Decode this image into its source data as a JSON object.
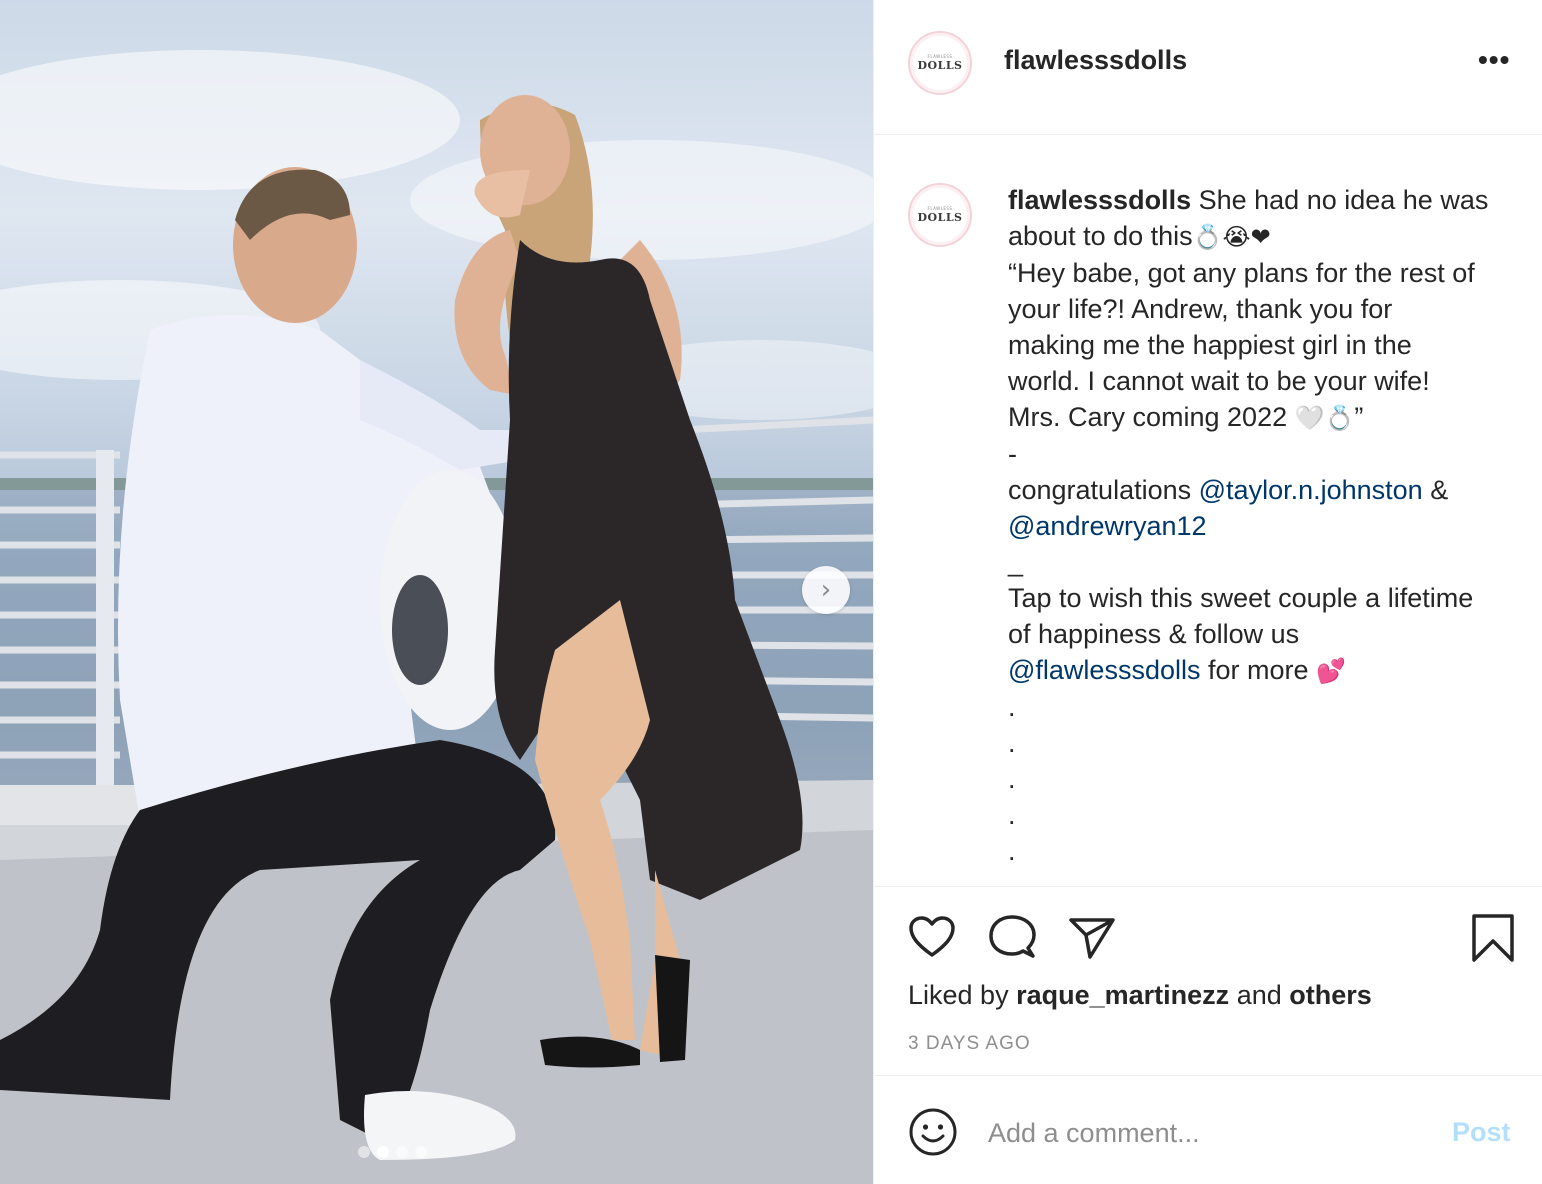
{
  "post": {
    "username": "flawlesssdolls",
    "avatar": {
      "top_text": "FLAWLESS",
      "main_text": "DOLLS"
    },
    "more_label": "•••",
    "next_arrow": "›",
    "carousel": {
      "slide_count": 4,
      "active_index": 1
    }
  },
  "caption": {
    "username": "flawlesssdolls",
    "line1": "She had no idea he was",
    "line2": "about to do this",
    "line2_emoji": "💍😭❤",
    "line3": "“Hey babe, got any plans for the rest of",
    "line4": "your life?! Andrew, thank you for",
    "line5": "making me the happiest girl in the",
    "line6": "world. I cannot wait to be your wife!",
    "line7": "Mrs. Cary coming 2022",
    "line7_emoji": "🤍💍",
    "line7_end": "”",
    "line8": "-",
    "line9_prefix": "congratulations",
    "mention1": "@taylor.n.johnston",
    "line9_suffix": "&",
    "mention2": "@andrewryan12",
    "line11": "_",
    "line12": "Tap to wish this sweet couple a lifetime",
    "line13": "of happiness & follow us",
    "mention3": "@flawlesssdolls",
    "line14_suffix": "for more",
    "line14_emoji": "💕",
    "dots": [
      ".",
      ".",
      ".",
      ".",
      "."
    ]
  },
  "actions": {
    "liked_by_prefix": "Liked by",
    "liked_by_user": "raque_martinezz",
    "liked_by_and": "and",
    "liked_by_others": "others",
    "timestamp": "3 DAYS AGO"
  },
  "comment": {
    "placeholder": "Add a comment...",
    "post_label": "Post"
  }
}
